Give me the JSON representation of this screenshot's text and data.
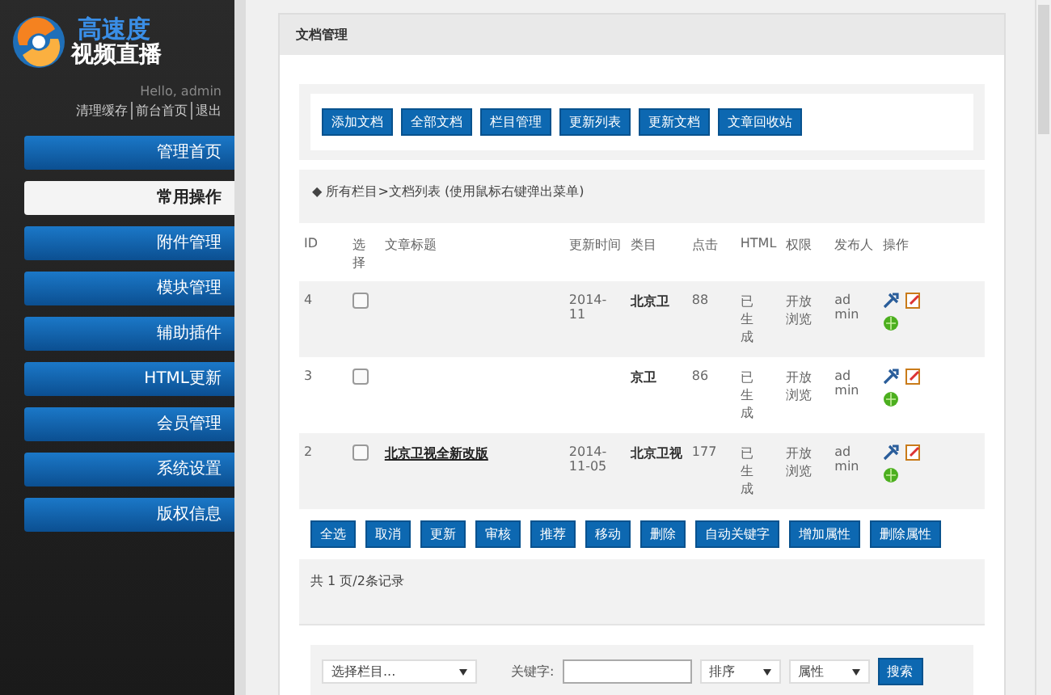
{
  "logo": {
    "line_1": "高速度",
    "line_2": "视频直播"
  },
  "user": {
    "greeting": "Hello, admin",
    "links": [
      "清理缓存",
      "前台首页",
      "退出"
    ]
  },
  "sidebar": {
    "items": [
      {
        "label": "管理首页",
        "selected": false
      },
      {
        "label": "常用操作",
        "selected": true
      },
      {
        "label": "附件管理",
        "selected": false
      },
      {
        "label": "模块管理",
        "selected": false
      },
      {
        "label": "辅助插件",
        "selected": false
      },
      {
        "label": "HTML更新",
        "selected": false
      },
      {
        "label": "会员管理",
        "selected": false
      },
      {
        "label": "系统设置",
        "selected": false
      },
      {
        "label": "版权信息",
        "selected": false
      }
    ]
  },
  "panel": {
    "title": "文档管理"
  },
  "toolbar": [
    "添加文档",
    "全部文档",
    "栏目管理",
    "更新列表",
    "更新文档",
    "文章回收站"
  ],
  "breadcrumb": "◆ 所有栏目>文档列表  (使用鼠标右键弹出菜单)",
  "table": {
    "columns": [
      "ID",
      "选择",
      "文章标题",
      "更新时间",
      "类目",
      "点击",
      "HTML",
      "权限",
      "发布人",
      "操作"
    ],
    "rows": [
      {
        "id": "4",
        "checked": false,
        "time": "2014-11",
        "category": "北京卫",
        "clicks": "88",
        "html": "已生成",
        "access": "开放浏览",
        "author": "admin"
      },
      {
        "id": "3",
        "checked": false,
        "category": "京卫",
        "clicks": "86",
        "html": "已生成",
        "access": "开放浏览",
        "author": "admin"
      },
      {
        "id": "2",
        "checked": false,
        "title": "北京卫视全新改版",
        "time": "2014-11-05",
        "category": "北京卫视",
        "clicks": "177",
        "html": "已生成",
        "access": "开放浏览",
        "author": "admin"
      }
    ]
  },
  "actions": [
    "全选",
    "取消",
    "更新",
    "审核",
    "推荐",
    "移动",
    "删除",
    "自动关键字",
    "增加属性",
    "删除属性"
  ],
  "pagination": "共 1 页/2条记录",
  "search": {
    "column_select": "选择栏目...",
    "keyword_label": "关键字:",
    "order_select": "排序",
    "attr_select": "属性",
    "button": "搜索"
  }
}
